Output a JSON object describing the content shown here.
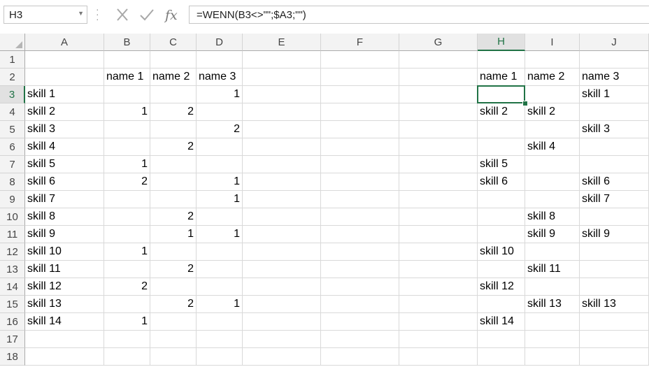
{
  "formula_bar": {
    "name_box": "H3",
    "formula": "=WENN(B3<>\"\";$A3;\"\")",
    "icons": [
      "more-options-icon",
      "cancel-icon",
      "enter-icon",
      "insert-function-icon"
    ]
  },
  "sheet": {
    "active_cell": "H3",
    "columns": [
      "A",
      "B",
      "C",
      "D",
      "E",
      "F",
      "G",
      "H",
      "I",
      "J"
    ],
    "rows": [
      "1",
      "2",
      "3",
      "4",
      "5",
      "6",
      "7",
      "8",
      "9",
      "10",
      "11",
      "12",
      "13",
      "14",
      "15",
      "16",
      "17",
      "18"
    ],
    "cells": {
      "A3": "skill 1",
      "A4": "skill 2",
      "A5": "skill 3",
      "A6": "skill 4",
      "A7": "skill 5",
      "A8": "skill 6",
      "A9": "skill 7",
      "A10": "skill 8",
      "A11": "skill 9",
      "A12": "skill 10",
      "A13": "skill 11",
      "A14": "skill 12",
      "A15": "skill 13",
      "A16": "skill 14",
      "B2": "name 1",
      "C2": "name 2",
      "D2": "name 3",
      "D3": "1",
      "B4": "1",
      "C4": "2",
      "D5": "2",
      "C6": "2",
      "B7": "1",
      "B8": "2",
      "D8": "1",
      "D9": "1",
      "C10": "2",
      "C11": "1",
      "D11": "1",
      "B12": "1",
      "C13": "2",
      "B14": "2",
      "C15": "2",
      "D15": "1",
      "B16": "1",
      "H2": "name 1",
      "I2": "name 2",
      "J2": "name 3",
      "J3": "skill 1",
      "H4": "skill 2",
      "I4": "skill 2",
      "J5": "skill 3",
      "I6": "skill 4",
      "H7": "skill 5",
      "H8": "skill 6",
      "J8": "skill 6",
      "J9": "skill 7",
      "I10": "skill 8",
      "I11": "skill 9",
      "J11": "skill 9",
      "H12": "skill 10",
      "I13": "skill 11",
      "H14": "skill 12",
      "I15": "skill 13",
      "J15": "skill 13",
      "H16": "skill 14"
    },
    "colors": {
      "accent": "#217346",
      "header_bg": "#f3f3f3",
      "gridline": "#d9d9d9"
    }
  }
}
